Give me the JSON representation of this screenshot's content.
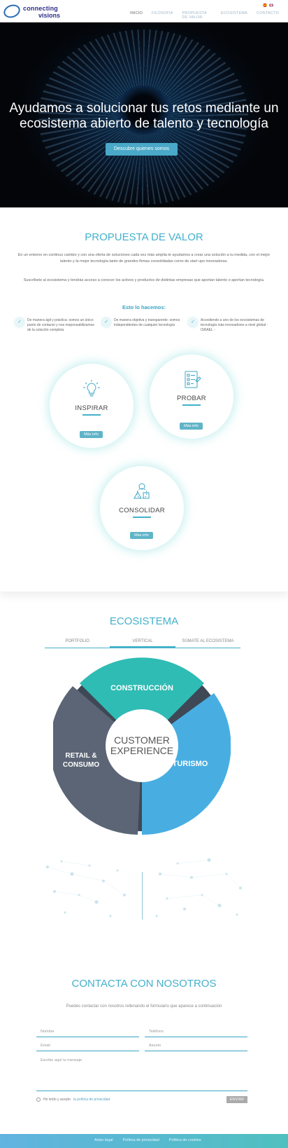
{
  "header": {
    "logo_line1": "connecting",
    "logo_line2": "visions",
    "nav": [
      {
        "label": "INICIO",
        "active": true
      },
      {
        "label": "FILOSOFÍA",
        "active": false
      },
      {
        "label": "PROPUESTA DE VALOR",
        "active": false
      },
      {
        "label": "ECOSISTEMA",
        "active": false
      },
      {
        "label": "CONTACTO",
        "active": false
      }
    ],
    "languages": [
      "es-flag-icon",
      "en-flag-icon"
    ]
  },
  "hero": {
    "title": "Ayudamos a solucionar tus retos mediante un ecosistema abierto de talento y tecnología",
    "cta": "Descubre quienes somos"
  },
  "value": {
    "title": "PROPUESTA DE VALOR",
    "para1": "En un entorno en continuo cambio y con una oferta de soluciones cada vez más amplia te ayudamos a crear una solución a tu medida, con el mejor talento y la mejor tecnología tanto de grandes firmas consolidadas como de start ups innovadoras.",
    "para2": "Suscríbete al ecosistema y tendrás acceso a conocer los activos y productos de distintas empresas que aportan talento o aportan tecnología.",
    "how_title": "Esto lo hacemos:",
    "features": [
      "De manera ágil y práctica: somos un único punto de contacto y nos responsabilizamos de la solución completa",
      "De manera objetiva y transparente: somos independientes de cualquier tecnología",
      "Accediendo a uno de los ecosistemas de tecnología más innovadores a nivel global - ISRAEL -"
    ],
    "cards": [
      {
        "label": "INSPIRAR",
        "more": "Más info",
        "icon": "lightbulb-icon"
      },
      {
        "label": "PROBAR",
        "more": "Más info",
        "icon": "checklist-icon"
      },
      {
        "label": "CONSOLIDAR",
        "more": "Más info",
        "icon": "cycle-shapes-icon"
      }
    ]
  },
  "ecosystem": {
    "title": "ECOSISTEMA",
    "tabs": [
      {
        "label": "PORTFOLIO",
        "active": false
      },
      {
        "label": "VERTICAL",
        "active": true
      },
      {
        "label": "SÚMATE AL ECOSISTEMA",
        "active": false
      }
    ],
    "center_line1": "CUSTOMER",
    "center_line2": "EXPERIENCE",
    "segments": [
      {
        "line1": "CONSTRUCCIÓN",
        "line2": "",
        "color": "#2fbcb4"
      },
      {
        "line1": "TURISMO",
        "line2": "",
        "color": "#48aee2"
      },
      {
        "line1": "RETAIL &",
        "line2": "CONSUMO",
        "color": "#5b6575"
      }
    ]
  },
  "contact": {
    "title": "CONTACTA CON NOSOTROS",
    "subtitle": "Puedes contactar con nosotros rellenando el formulario que aparece a continuación",
    "fields": {
      "name": "Nombre",
      "phone": "Teléfono",
      "email": "Email",
      "subject": "Asunto",
      "message": "Escribe aquí tu mensaje"
    },
    "privacy_prefix": "He leído y acepto",
    "privacy_link": "la política de privacidad",
    "send": "ENVIAR"
  },
  "footer": {
    "links": [
      "Aviso legal",
      "Política de privacidad",
      "Política de cookies"
    ]
  }
}
